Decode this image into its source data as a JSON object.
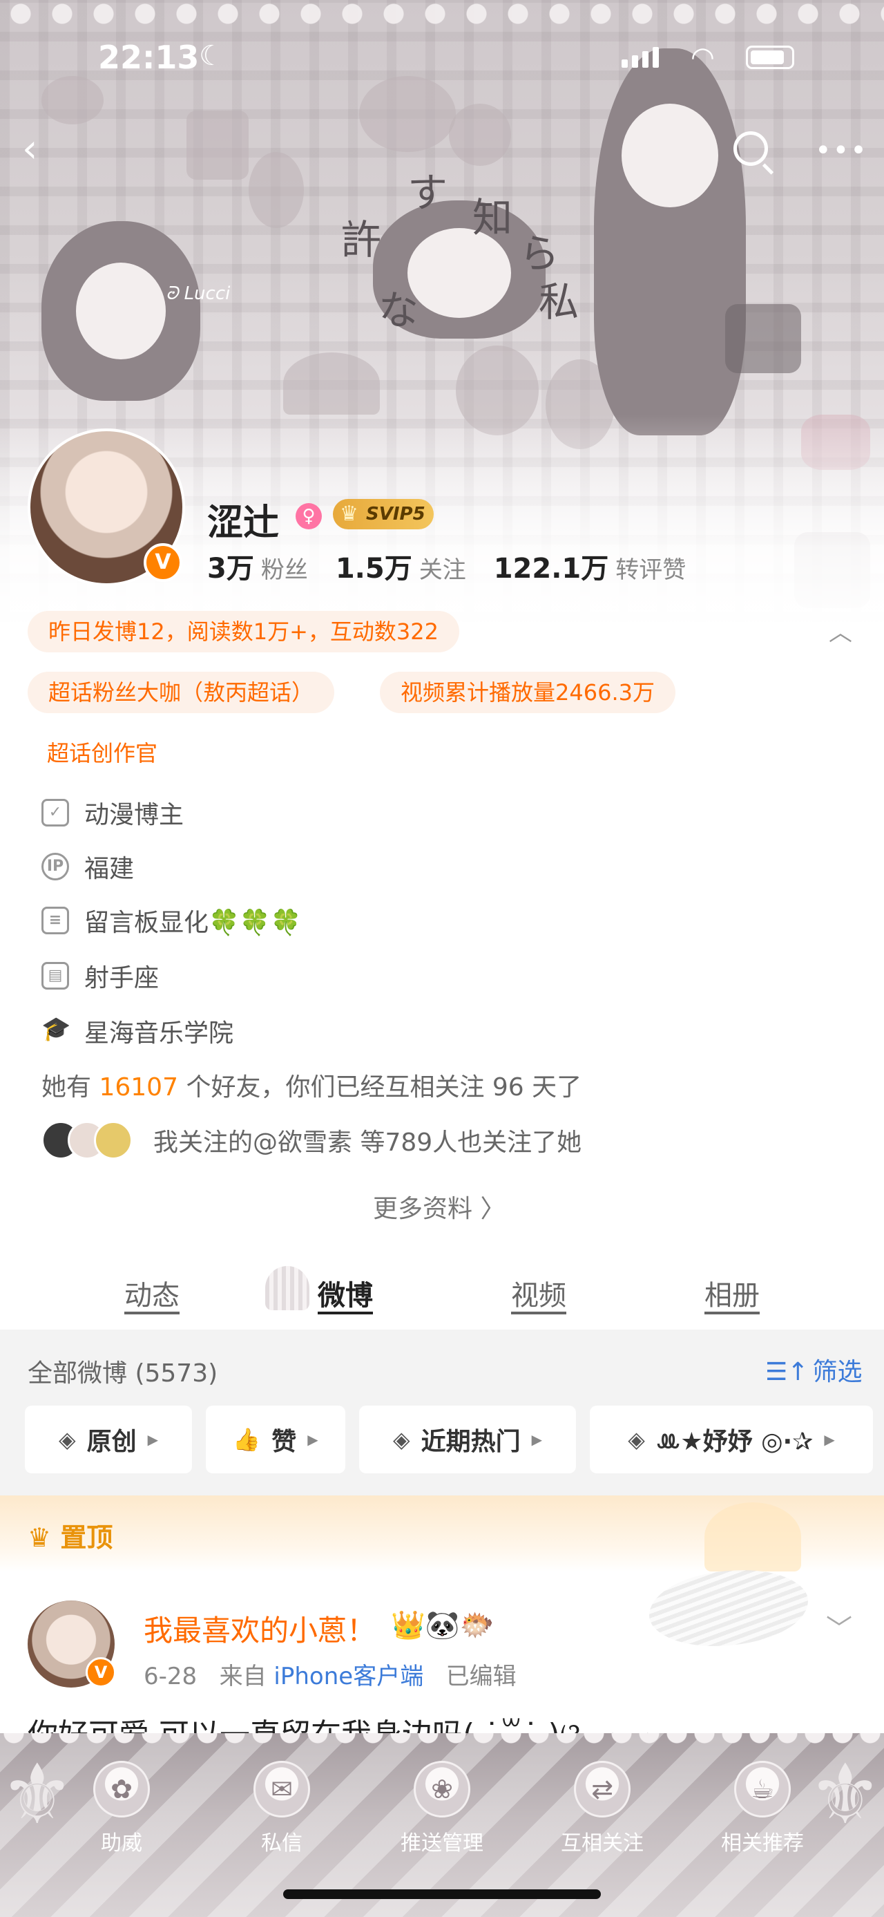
{
  "status_bar": {
    "time": "22:13"
  },
  "banner": {
    "caption": "ᘒ Lucci",
    "doodle_chars": [
      "許",
      "す",
      "知",
      "ら",
      "な",
      "私"
    ]
  },
  "profile": {
    "name": "涩辻",
    "badge": "SVIP5",
    "stats": [
      {
        "value": "3万",
        "label": "粉丝"
      },
      {
        "value": "1.5万",
        "label": "关注"
      },
      {
        "value": "122.1万",
        "label": "转评赞"
      }
    ],
    "chips": [
      "昨日发博12，阅读数1万+，互动数322",
      "超话粉丝大咖（敖丙超话）",
      "视频累计播放量2466.3万",
      "超话创作官"
    ],
    "info": [
      {
        "icon": "verified-shield-icon",
        "text": "动漫博主"
      },
      {
        "icon": "ip-location-icon",
        "text": "福建"
      },
      {
        "icon": "document-icon",
        "text": "留言板显化🍀🍀🍀"
      },
      {
        "icon": "calendar-icon",
        "text": "射手座"
      },
      {
        "icon": "graduation-cap-icon",
        "text": "星海音乐学院"
      }
    ],
    "friends_prefix": "她有",
    "friends_count": "16107",
    "friends_suffix": "个好友，你们已经互相关注 96 天了",
    "mutual_text": "我关注的@欲雪素 等789人也关注了她",
    "more_info": "更多资料 〉"
  },
  "tabs": [
    {
      "label": "动态",
      "active": false
    },
    {
      "label": "微博",
      "active": true
    },
    {
      "label": "视频",
      "active": false
    },
    {
      "label": "相册",
      "active": false
    }
  ],
  "feed": {
    "all_count": "全部微博 (5573)",
    "filter_label": "筛选",
    "pills": [
      {
        "icon": "layers-icon",
        "label": "原创"
      },
      {
        "icon": "thumbs-up-icon",
        "label": "赞"
      },
      {
        "icon": "layers-icon",
        "label": "近期热门"
      },
      {
        "icon": "layers-icon",
        "label": "ꔛ★妤妤 ◎·✰"
      }
    ]
  },
  "pinned": {
    "label": "置顶",
    "author": "我最喜欢的小蒽！",
    "author_emojis": "👑🐼🐡",
    "date": "6-28",
    "source_prefix": "来自",
    "source": "iPhone客户端",
    "edited": "已编辑",
    "text": "你好可爱 可以一直留在我身边吗( ˙꒳​˙ )ଓ ~ ~"
  },
  "bottom_actions": [
    {
      "icon": "boost-icon",
      "label": "助威"
    },
    {
      "icon": "message-icon",
      "label": "私信"
    },
    {
      "icon": "push-manage-icon",
      "label": "推送管理"
    },
    {
      "icon": "mutual-follow-icon",
      "label": "互相关注"
    },
    {
      "icon": "recommend-icon",
      "label": "相关推荐"
    }
  ],
  "colors": {
    "accent": "#ff8200",
    "link": "#3c7bd9",
    "chip_bg": "#fdf1e9",
    "chip_text": "#ff6a00"
  }
}
